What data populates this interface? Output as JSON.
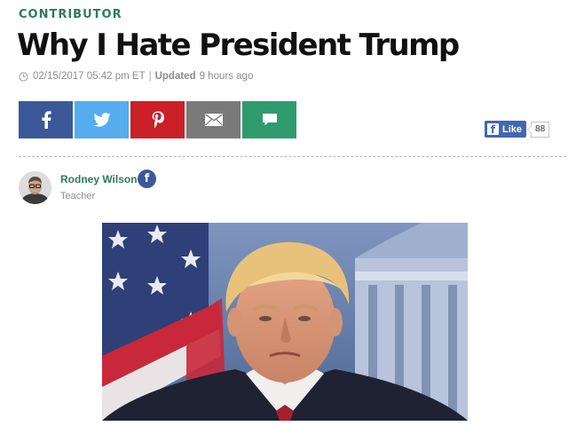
{
  "article": {
    "kicker": "CONTRIBUTOR",
    "title": "Why I Hate President Trump",
    "timestamp": "02/15/2017 05:42 pm ET",
    "separator": "|",
    "updated_label": "Updated",
    "updated_ago": "9 hours ago"
  },
  "share": {
    "buttons": [
      {
        "name": "facebook",
        "icon": "facebook-icon",
        "color": "#3b5998"
      },
      {
        "name": "twitter",
        "icon": "twitter-icon",
        "color": "#55acee"
      },
      {
        "name": "pinterest",
        "icon": "pinterest-icon",
        "color": "#cb2027"
      },
      {
        "name": "email",
        "icon": "envelope-icon",
        "color": "#7a7a7a"
      },
      {
        "name": "comment",
        "icon": "comment-icon",
        "color": "#2f9b6e"
      }
    ],
    "fb_like": {
      "label": "Like",
      "count": "88",
      "icon": "f"
    }
  },
  "author": {
    "name": "Rodney Wilson",
    "role": "Teacher",
    "facebook_icon": "f"
  },
  "colors": {
    "accent_green": "#2e7a5b",
    "facebook_blue": "#3b5998"
  }
}
